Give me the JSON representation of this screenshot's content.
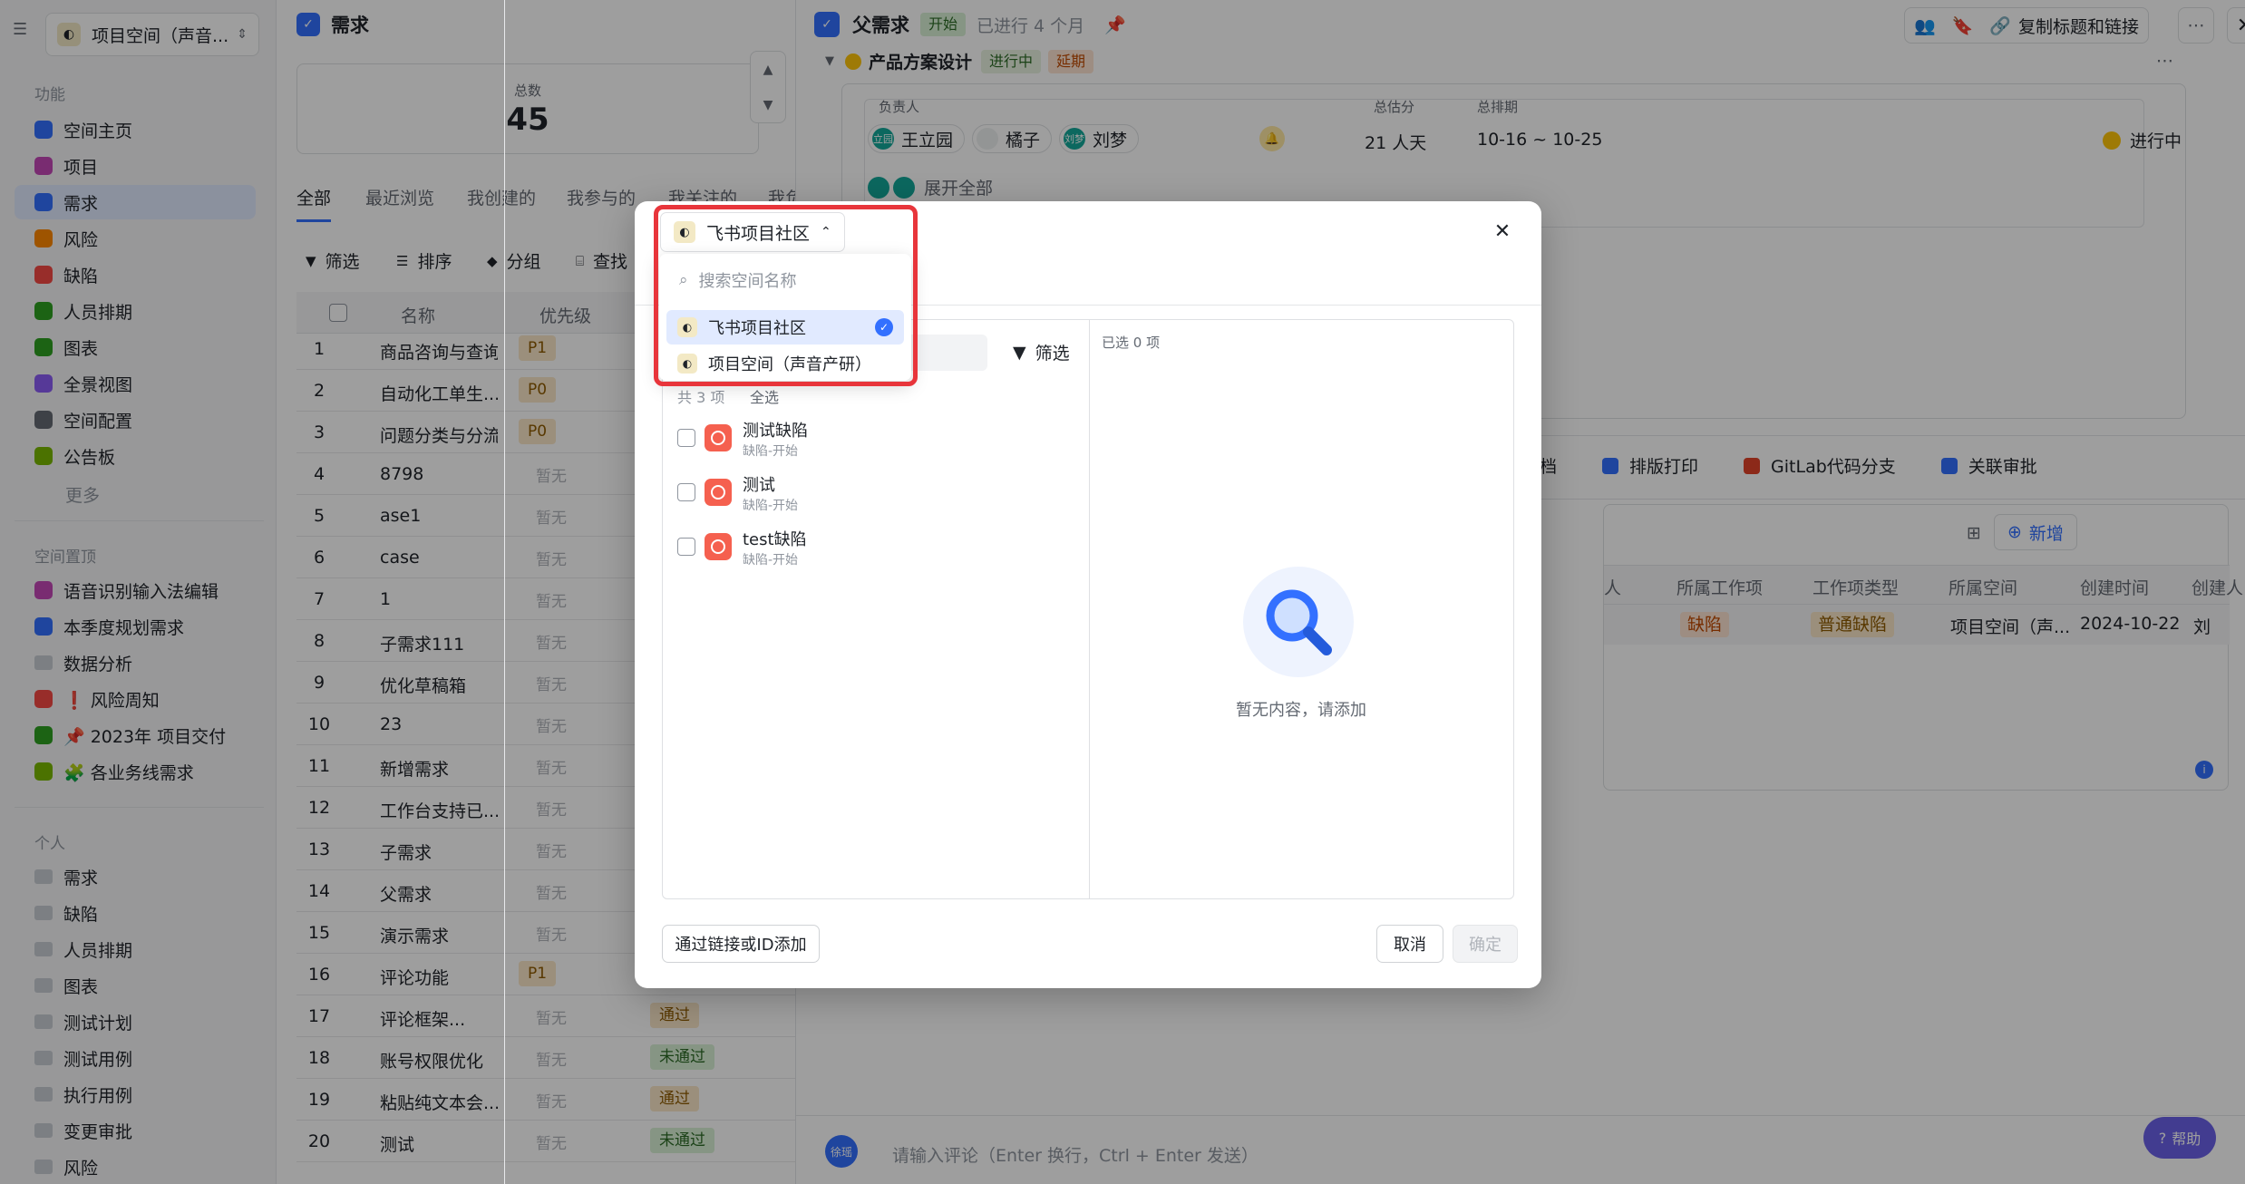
{
  "sidebar": {
    "space_name": "项目空间（声音...",
    "section_features": "功能",
    "features": [
      {
        "label": "空间主页",
        "color": "#3370ff"
      },
      {
        "label": "项目",
        "color": "#c348b7"
      },
      {
        "label": "需求",
        "color": "#3370ff"
      },
      {
        "label": "风险",
        "color": "#ff8800"
      },
      {
        "label": "缺陷",
        "color": "#f54a45"
      },
      {
        "label": "人员排期",
        "color": "#2ea121"
      },
      {
        "label": "图表",
        "color": "#2ea121"
      },
      {
        "label": "全景视图",
        "color": "#8b5cf6"
      },
      {
        "label": "空间配置",
        "color": "#646a73"
      },
      {
        "label": "公告板",
        "color": "#7ab800"
      }
    ],
    "more_label": "更多",
    "section_pinned": "空间置顶",
    "pinned": [
      {
        "label": "语音识别输入法编辑",
        "color": "#c348b7"
      },
      {
        "label": "本季度规划需求",
        "color": "#3370ff"
      },
      {
        "label": "数据分析",
        "color": ""
      },
      {
        "label": "❗ 风险周知",
        "color": "#f54a45"
      },
      {
        "label": "📌 2023年 项目交付",
        "color": "#2ea121"
      },
      {
        "label": "🧩 各业务线需求",
        "color": "#7ab800"
      }
    ],
    "section_personal": "个人",
    "personal": [
      "需求",
      "缺陷",
      "人员排期",
      "图表",
      "测试计划",
      "测试用例",
      "执行用例",
      "变更审批",
      "风险"
    ]
  },
  "list": {
    "title": "需求",
    "total_label": "总数",
    "total_value": "45",
    "tabs": [
      "全部",
      "最近浏览",
      "我创建的",
      "我参与的",
      "我关注的",
      "我负"
    ],
    "toolbar": [
      "筛选",
      "排序",
      "分组",
      "查找"
    ],
    "col_name": "名称",
    "col_priority": "优先级",
    "rows": [
      {
        "n": "1",
        "name": "商品咨询与查询",
        "pri": "P1",
        "st": ""
      },
      {
        "n": "2",
        "name": "自动化工单生...",
        "pri": "P0",
        "st": ""
      },
      {
        "n": "3",
        "name": "问题分类与分流",
        "pri": "P0",
        "st": ""
      },
      {
        "n": "4",
        "name": "8798",
        "pri": "暂无",
        "st": ""
      },
      {
        "n": "5",
        "name": "ase1",
        "pri": "暂无",
        "st": ""
      },
      {
        "n": "6",
        "name": "case",
        "pri": "暂无",
        "st": ""
      },
      {
        "n": "7",
        "name": "1",
        "pri": "暂无",
        "st": ""
      },
      {
        "n": "8",
        "name": "子需求111",
        "pri": "暂无",
        "st": ""
      },
      {
        "n": "9",
        "name": "优化草稿箱",
        "pri": "暂无",
        "st": ""
      },
      {
        "n": "10",
        "name": "23",
        "pri": "暂无",
        "st": ""
      },
      {
        "n": "11",
        "name": "新增需求",
        "pri": "暂无",
        "st": ""
      },
      {
        "n": "12",
        "name": "工作台支持已...",
        "pri": "暂无",
        "st": ""
      },
      {
        "n": "13",
        "name": "子需求",
        "pri": "暂无",
        "st": ""
      },
      {
        "n": "14",
        "name": "父需求",
        "pri": "暂无",
        "st": ""
      },
      {
        "n": "15",
        "name": "演示需求",
        "pri": "暂无",
        "st": ""
      },
      {
        "n": "16",
        "name": "评论功能",
        "pri": "P1",
        "st": ""
      },
      {
        "n": "17",
        "name": "评论框架...",
        "pri": "暂无",
        "st": "通过"
      },
      {
        "n": "18",
        "name": "账号权限优化",
        "pri": "暂无",
        "st": "未通过"
      },
      {
        "n": "19",
        "name": "粘贴纯文本会...",
        "pri": "暂无",
        "st": "通过"
      },
      {
        "n": "20",
        "name": "测试",
        "pri": "暂无",
        "st": "未通过"
      }
    ]
  },
  "detail": {
    "title": "父需求",
    "status": "开始",
    "elapsed": "已进行 4 个月",
    "copy_label": "复制标题和链接",
    "node_name": "产品方案设计",
    "node_status": "进行中",
    "node_delay": "延期",
    "col_owner": "负责人",
    "col_estimate": "总估分",
    "col_schedule": "总排期",
    "owners": [
      {
        "short": "立园",
        "name": "王立园",
        "color": "#14a89a"
      },
      {
        "short": "",
        "name": "橘子",
        "color": "#eef0f1"
      },
      {
        "short": "刘梦",
        "name": "刘梦",
        "color": "#14a89a"
      }
    ],
    "estimate": "21 人天",
    "schedule": "10-16 ~ 10-25",
    "progress_status": "进行中",
    "expand_all": "展开全部",
    "tabs_lower": [
      "档",
      "排版打印",
      "GitLab代码分支",
      "关联审批"
    ],
    "add_label": "新增",
    "table_headers": [
      "人",
      "所属工作项",
      "工作项类型",
      "所属空间",
      "创建时间",
      "创建人"
    ],
    "table_row": [
      "缺陷",
      "普通缺陷",
      "项目空间（声...",
      "2024-10-22",
      "刘"
    ],
    "comment_avatar": "徐瑶",
    "comment_placeholder": "请输入评论（Enter 换行，Ctrl + Enter 发送）",
    "help_label": "帮助"
  },
  "modal": {
    "space_selected": "飞书项目社区",
    "search_placeholder": "搜索空间名称",
    "space_options": [
      {
        "label": "飞书项目社区",
        "selected": true
      },
      {
        "label": "项目空间（声音产研）",
        "selected": false
      }
    ],
    "filter_label": "筛选",
    "count_label": "共 3 项",
    "select_all": "全选",
    "items": [
      {
        "title": "测试缺陷",
        "sub": "缺陷-开始"
      },
      {
        "title": "测试",
        "sub": "缺陷-开始"
      },
      {
        "title": "test缺陷",
        "sub": "缺陷-开始"
      }
    ],
    "selected_count": "已选 0 项",
    "empty_text": "暂无内容，请添加",
    "add_by_link": "通过链接或ID添加",
    "cancel": "取消",
    "confirm": "确定"
  }
}
